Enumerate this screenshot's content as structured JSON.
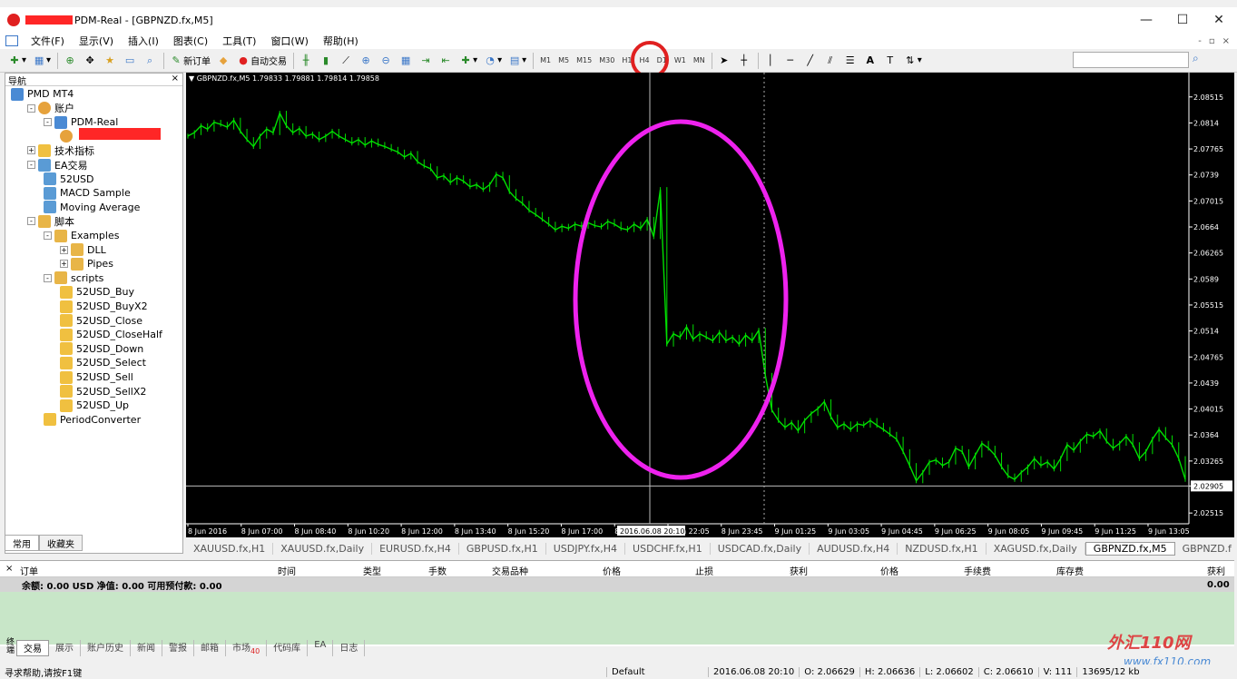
{
  "window": {
    "title": "PDM-Real - [GBPNZD.fx,M5]",
    "controls": {
      "minimize": "—",
      "maximize": "☐",
      "close": "✕"
    }
  },
  "menu": {
    "items": [
      "文件(F)",
      "显示(V)",
      "插入(I)",
      "图表(C)",
      "工具(T)",
      "窗口(W)",
      "帮助(H)"
    ],
    "mdi": [
      "-",
      "▫",
      "×"
    ]
  },
  "toolbar": {
    "new_order": "新订单",
    "auto_trading": "自动交易",
    "timeframes": [
      "M1",
      "M5",
      "M15",
      "M30",
      "H1",
      "H4",
      "D1",
      "W1",
      "MN"
    ],
    "highlighted_timeframe": "M5",
    "text_tool": "A",
    "search_placeholder": ""
  },
  "navigator": {
    "title": "导航",
    "close": "×",
    "items": [
      {
        "label": "PMD MT4",
        "level": 0,
        "icon": "terminal-icon"
      },
      {
        "label": "账户",
        "level": 1,
        "icon": "accounts-icon",
        "toggle": "-"
      },
      {
        "label": "PDM-Real",
        "level": 2,
        "icon": "server-icon",
        "toggle": "-"
      },
      {
        "label": "",
        "level": 3,
        "icon": "user-icon"
      },
      {
        "label": "技术指标",
        "level": 1,
        "icon": "indicators-icon",
        "toggle": "+"
      },
      {
        "label": "EA交易",
        "level": 1,
        "icon": "ea-icon",
        "toggle": "-"
      },
      {
        "label": "52USD",
        "level": 2,
        "icon": "ea-icon"
      },
      {
        "label": "MACD Sample",
        "level": 2,
        "icon": "ea-icon"
      },
      {
        "label": "Moving Average",
        "level": 2,
        "icon": "ea-icon"
      },
      {
        "label": "脚本",
        "level": 1,
        "icon": "scripts-icon",
        "toggle": "-"
      },
      {
        "label": "Examples",
        "level": 2,
        "icon": "folder-icon",
        "toggle": "-"
      },
      {
        "label": "DLL",
        "level": 3,
        "icon": "folder-icon",
        "toggle": "+"
      },
      {
        "label": "Pipes",
        "level": 3,
        "icon": "folder-icon",
        "toggle": "+"
      },
      {
        "label": "scripts",
        "level": 2,
        "icon": "folder-icon",
        "toggle": "-"
      },
      {
        "label": "52USD_Buy",
        "level": 3,
        "icon": "script-icon"
      },
      {
        "label": "52USD_BuyX2",
        "level": 3,
        "icon": "script-icon"
      },
      {
        "label": "52USD_Close",
        "level": 3,
        "icon": "script-icon"
      },
      {
        "label": "52USD_CloseHalf",
        "level": 3,
        "icon": "script-icon"
      },
      {
        "label": "52USD_Down",
        "level": 3,
        "icon": "script-icon"
      },
      {
        "label": "52USD_Select",
        "level": 3,
        "icon": "script-icon"
      },
      {
        "label": "52USD_Sell",
        "level": 3,
        "icon": "script-icon"
      },
      {
        "label": "52USD_SellX2",
        "level": 3,
        "icon": "script-icon"
      },
      {
        "label": "52USD_Up",
        "level": 3,
        "icon": "script-icon"
      },
      {
        "label": "PeriodConverter",
        "level": 2,
        "icon": "script-icon"
      }
    ],
    "tabs": [
      "常用",
      "收藏夹"
    ]
  },
  "chart": {
    "info": "▼ GBPNZD.fx,M5  1.79833 1.79881 1.79814 1.79858",
    "crosshair_label": "2016.06.08 20:10",
    "current_price_label": "2.02905",
    "colors": {
      "background": "#000000",
      "candles": "#00e000",
      "axis": "#ffffff",
      "highlight": "#ee22ee"
    }
  },
  "chart_data": {
    "type": "line",
    "title": "",
    "xlabel": "",
    "ylabel": "",
    "ylim": [
      2.0236,
      2.088
    ],
    "y_ticks": [
      2.08515,
      2.0814,
      2.07765,
      2.0739,
      2.07015,
      2.0664,
      2.06265,
      2.0589,
      2.05515,
      2.0514,
      2.04765,
      2.0439,
      2.04015,
      2.0364,
      2.03265,
      2.02905,
      2.02515
    ],
    "x_ticks": [
      "8 Jun 2016",
      "8 Jun 07:00",
      "8 Jun 08:40",
      "8 Jun 10:20",
      "8 Jun 12:00",
      "8 Jun 13:40",
      "8 Jun 15:20",
      "8 Jun 17:00",
      "8 Jun 20:10",
      "8 Jun 22:05",
      "8 Jun 23:45",
      "9 Jun 01:25",
      "9 Jun 03:05",
      "9 Jun 04:45",
      "9 Jun 06:25",
      "9 Jun 08:05",
      "9 Jun 09:45",
      "9 Jun 11:25",
      "9 Jun 13:05"
    ],
    "series": [
      {
        "values": [
          2.0795,
          2.08,
          2.081,
          2.0805,
          2.0815,
          2.0812,
          2.0808,
          2.0818,
          2.0802,
          2.079,
          2.078,
          2.0795,
          2.0805,
          2.08,
          2.0828,
          2.081,
          2.08,
          2.0806,
          2.0795,
          2.0798,
          2.079,
          2.0795,
          2.0802,
          2.0795,
          2.079,
          2.0785,
          2.079,
          2.0782,
          2.0788,
          2.0783,
          2.078,
          2.0776,
          2.0772,
          2.0765,
          2.077,
          2.0758,
          2.0752,
          2.0748,
          2.0735,
          2.0738,
          2.0728,
          2.0735,
          2.073,
          2.0722,
          2.0725,
          2.0718,
          2.0725,
          2.074,
          2.0735,
          2.0715,
          2.0705,
          2.0698,
          2.0688,
          2.0682,
          2.0675,
          2.0668,
          2.066,
          2.0665,
          2.0662,
          2.0668,
          2.0665,
          2.067,
          2.0666,
          2.0664,
          2.0672,
          2.0668,
          2.0662,
          2.066,
          2.0668,
          2.0662,
          2.0675,
          2.065,
          2.0718,
          2.0495,
          2.051,
          2.0505,
          2.052,
          2.0502,
          2.051,
          2.0505,
          2.05,
          2.0512,
          2.05,
          2.0505,
          2.0495,
          2.0508,
          2.05,
          2.0515,
          2.045,
          2.04,
          2.0385,
          2.0375,
          2.0382,
          2.037,
          2.0385,
          2.0395,
          2.0402,
          2.0412,
          2.039,
          2.0375,
          2.038,
          2.0372,
          2.038,
          2.0378,
          2.0385,
          2.0378,
          2.0372,
          2.0365,
          2.0358,
          2.034,
          2.032,
          2.0298,
          2.031,
          2.0325,
          2.0328,
          2.032,
          2.0325,
          2.0345,
          2.034,
          2.0318,
          2.0335,
          2.0352,
          2.0345,
          2.0335,
          2.0318,
          2.0305,
          2.03,
          2.031,
          2.0318,
          2.033,
          2.032,
          2.0325,
          2.0315,
          2.033,
          2.035,
          2.0342,
          2.0355,
          2.0365,
          2.0362,
          2.037,
          2.0355,
          2.0345,
          2.0352,
          2.0362,
          2.035,
          2.033,
          2.034,
          2.0358,
          2.0372,
          2.036,
          2.035,
          2.033,
          2.03
        ]
      }
    ]
  },
  "chart_tabs": [
    "XAUUSD.fx,H1",
    "XAUUSD.fx,Daily",
    "EURUSD.fx,H4",
    "GBPUSD.fx,H1",
    "USDJPY.fx,H4",
    "USDCHF.fx,H1",
    "USDCAD.fx,Daily",
    "AUDUSD.fx,H4",
    "NZDUSD.fx,H1",
    "XAGUSD.fx,Daily",
    "GBPNZD.fx,M5",
    "GBPNZD.f"
  ],
  "active_chart_tab": "GBPNZD.fx,M5",
  "terminal": {
    "close": "×",
    "columns": [
      "订单",
      "时间",
      "类型",
      "手数",
      "交易品种",
      "价格",
      "止损",
      "获利",
      "价格",
      "手续费",
      "库存费",
      "获利"
    ],
    "balance_row": "余额: 0.00 USD  净值: 0.00  可用预付款: 0.00",
    "balance_profit": "0.00",
    "side_label": "终端",
    "tabs": [
      "交易",
      "展示",
      "账户历史",
      "新闻",
      "警报",
      "邮箱",
      "市场",
      "代码库",
      "EA",
      "日志"
    ],
    "market_badge": "40"
  },
  "status": {
    "help": "寻求帮助,请按F1键",
    "profile": "Default",
    "datetime": "2016.06.08 20:10",
    "open": "O: 2.06629",
    "high": "H: 2.06636",
    "low": "L: 2.06602",
    "close": "C: 2.06610",
    "volume": "V: 111",
    "traffic": "13695/12 kb"
  },
  "watermark": {
    "text": "外汇110网",
    "url": "www.fx110.com"
  }
}
